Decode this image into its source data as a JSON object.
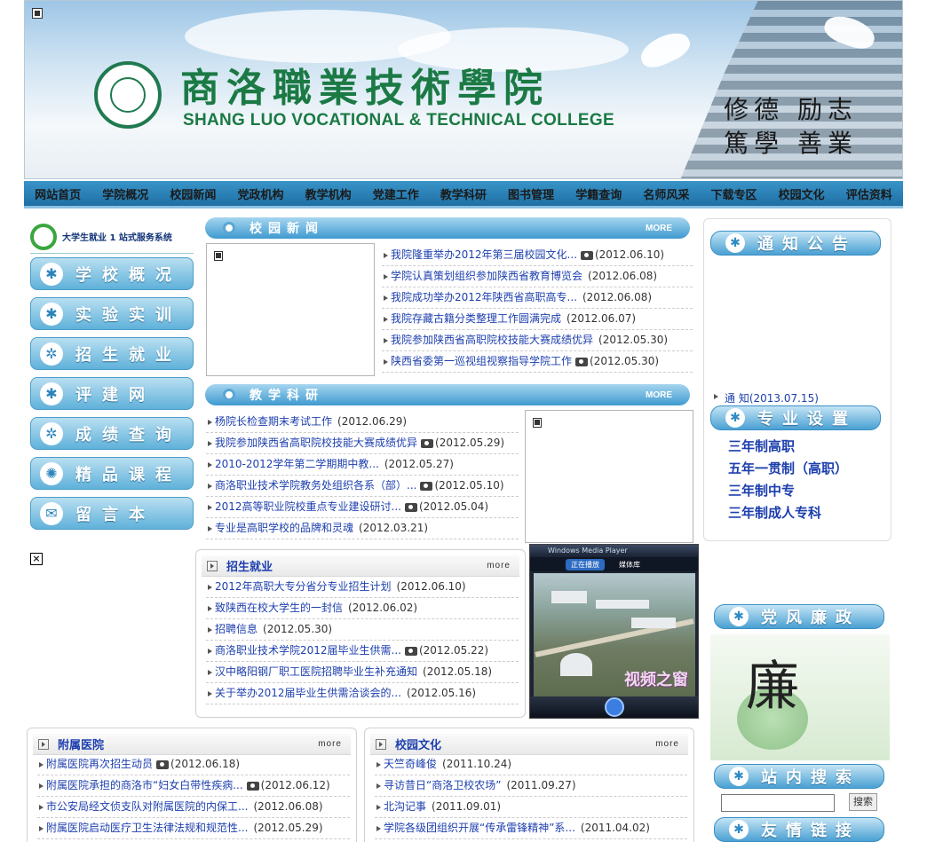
{
  "banner": {
    "title_cn": "商洛職業技術學院",
    "title_en": "SHANG LUO VOCATIONAL & TECHNICAL COLLEGE",
    "motto_line1": "修德 励志",
    "motto_line2": "篤學 善業"
  },
  "nav": [
    "网站首页",
    "学院概况",
    "校园新闻",
    "党政机构",
    "教学机构",
    "党建工作",
    "教学科研",
    "图书管理",
    "学籍查询",
    "名师风采",
    "下载专区",
    "校园文化",
    "评估资料"
  ],
  "left": {
    "jiuye": "大学生就业 1 站式服务系统",
    "buttons": [
      "学校概况",
      "实验实训",
      "招生就业",
      "评建网",
      "成绩查询",
      "精品课程",
      "留言本"
    ]
  },
  "campus_news": {
    "title": "校园新闻",
    "more": "MORE",
    "items": [
      {
        "text": "我院隆重举办2012年第三届校园文化...",
        "photo": true,
        "date": "(2012.06.10)"
      },
      {
        "text": "学院认真策划组织参加陕西省教育博览会",
        "photo": false,
        "date": "(2012.06.08)"
      },
      {
        "text": "我院成功举办2012年陕西省高职高专...",
        "photo": false,
        "date": "(2012.06.08)"
      },
      {
        "text": "我院存藏古籍分类整理工作圆满完成",
        "photo": false,
        "date": "(2012.06.07)"
      },
      {
        "text": "我院参加陕西省高职院校技能大赛成绩优异",
        "photo": false,
        "date": "(2012.05.30)"
      },
      {
        "text": "陕西省委第一巡视组视察指导学院工作",
        "photo": true,
        "date": "(2012.05.30)"
      }
    ]
  },
  "teaching": {
    "title": "教学科研",
    "more": "MORE",
    "items": [
      {
        "text": "杨院长检查期末考试工作",
        "photo": false,
        "date": "(2012.06.29)"
      },
      {
        "text": "我院参加陕西省高职院校技能大赛成绩优异",
        "photo": true,
        "date": "(2012.05.29)"
      },
      {
        "text": "2010-2012学年第二学期期中教...",
        "photo": false,
        "date": "(2012.05.27)"
      },
      {
        "text": "商洛职业技术学院教务处组织各系（部）...",
        "photo": true,
        "date": "(2012.05.10)"
      },
      {
        "text": "2012高等职业院校重点专业建设研讨...",
        "photo": true,
        "date": "(2012.05.04)"
      },
      {
        "text": "专业是高职学校的品牌和灵魂",
        "photo": false,
        "date": "(2012.03.21)"
      }
    ]
  },
  "employment": {
    "title": "招生就业",
    "more": "more",
    "items": [
      {
        "text": "2012年高职大专分省分专业招生计划",
        "photo": false,
        "date": "(2012.06.10)"
      },
      {
        "text": "致陕西在校大学生的一封信",
        "photo": false,
        "date": "(2012.06.02)"
      },
      {
        "text": "招聘信息",
        "photo": false,
        "date": "(2012.05.30)"
      },
      {
        "text": "商洛职业技术学院2012届毕业生供需...",
        "photo": true,
        "date": "(2012.05.22)"
      },
      {
        "text": "汉中略阳钢厂职工医院招聘毕业生补充通知",
        "photo": false,
        "date": "(2012.05.18)"
      },
      {
        "text": "关于举办2012届毕业生供需洽谈会的...",
        "photo": false,
        "date": "(2012.05.16)"
      }
    ]
  },
  "hospital": {
    "title": "附属医院",
    "more": "more",
    "items": [
      {
        "text": "附属医院再次招生动员",
        "photo": true,
        "date": "(2012.06.18)"
      },
      {
        "text": "附属医院承担的商洛市“妇女白带性疾病...",
        "photo": true,
        "date": "(2012.06.12)"
      },
      {
        "text": "市公安局经文侦支队对附属医院的内保工...",
        "photo": false,
        "date": "(2012.06.08)"
      },
      {
        "text": "附属医院启动医疗卫生法律法规和规范性...",
        "photo": false,
        "date": "(2012.05.29)"
      }
    ]
  },
  "culture": {
    "title": "校园文化",
    "more": "more",
    "items": [
      {
        "text": "天竺奇峰俊",
        "photo": false,
        "date": "(2011.10.24)"
      },
      {
        "text": "寻访昔日“商洛卫校农场”",
        "photo": false,
        "date": "(2011.09.27)"
      },
      {
        "text": "北沟记事",
        "photo": false,
        "date": "(2011.09.01)"
      },
      {
        "text": "学院各级团组织开展“传承雷锋精神”系...",
        "photo": false,
        "date": "(2011.04.02)"
      }
    ]
  },
  "right": {
    "notice_title": "通知公告",
    "notice_item": "通 知(2013.07.15)",
    "major_title": "专业设置",
    "majors": [
      "三年制高职",
      "五年一贯制（高职）",
      "三年制中专",
      "三年制成人专科"
    ],
    "party_title": "党风廉政",
    "search_title": "站内搜索",
    "search_button": "搜索",
    "links_title": "友情链接"
  },
  "video": {
    "player_title": "Windows Media Player",
    "tab_playing": "正在播放",
    "tab_library": "媒体库",
    "overlay": "视频之窗"
  }
}
